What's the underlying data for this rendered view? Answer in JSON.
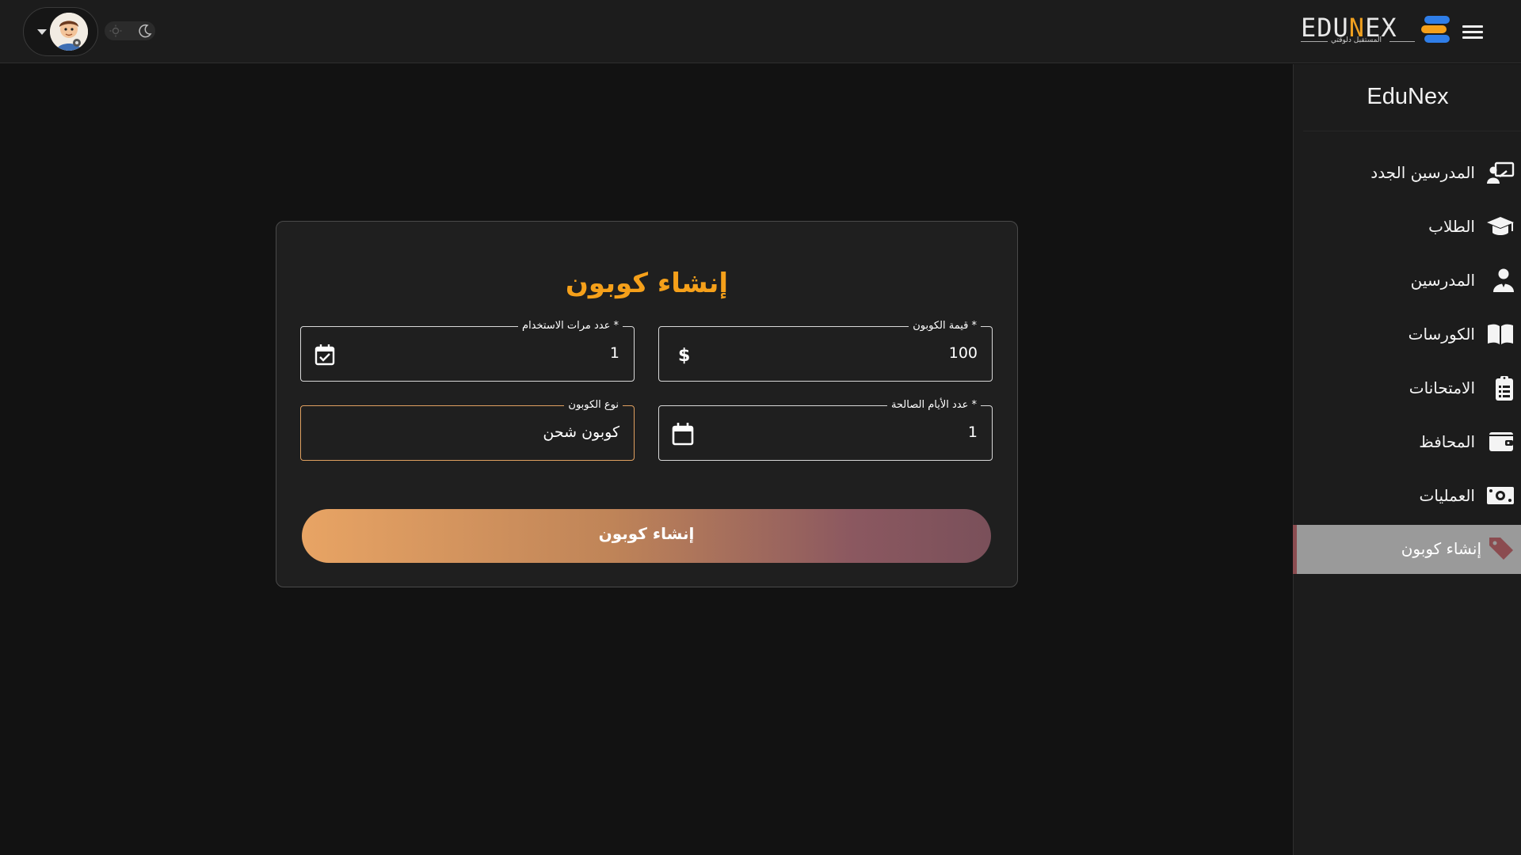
{
  "header": {
    "logo_text_pre": "EDU",
    "logo_text_n": "N",
    "logo_text_post": "EX",
    "logo_tagline": "المستقبل دلوقتي",
    "menu_icon": "hamburger-menu-icon",
    "theme_icons": [
      "sun-icon",
      "moon-icon"
    ],
    "user_icon": "avatar"
  },
  "sidebar": {
    "title": "EduNex",
    "items": [
      {
        "label": "المدرسين الجدد",
        "icon": "new-teachers-icon"
      },
      {
        "label": "الطلاب",
        "icon": "graduation-cap-icon"
      },
      {
        "label": "المدرسين",
        "icon": "teacher-icon"
      },
      {
        "label": "الكورسات",
        "icon": "book-icon"
      },
      {
        "label": "الامتحانات",
        "icon": "clipboard-icon"
      },
      {
        "label": "المحافظ",
        "icon": "wallet-icon"
      },
      {
        "label": "العمليات",
        "icon": "money-icon"
      },
      {
        "label": "إنشاء كوبون",
        "icon": "tag-icon",
        "active": true
      }
    ]
  },
  "form": {
    "title": "إنشاء كوبون",
    "coupon_value": {
      "label": "قيمة الكوبون *",
      "value": "100",
      "icon": "dollar-icon"
    },
    "usage_count": {
      "label": "عدد مرات الاستخدام *",
      "value": "1",
      "icon": "calendar-check-icon"
    },
    "valid_days": {
      "label": "عدد الأيام الصالحة *",
      "value": "1",
      "icon": "calendar-icon"
    },
    "coupon_type": {
      "label": "نوع الكوبون",
      "value": "كوبون شحن"
    },
    "submit_label": "إنشاء كوبون"
  },
  "colors": {
    "accent": "#f5a01a",
    "background": "#121212",
    "panel": "#1c1c1c",
    "active_item": "#9a9a9a"
  }
}
